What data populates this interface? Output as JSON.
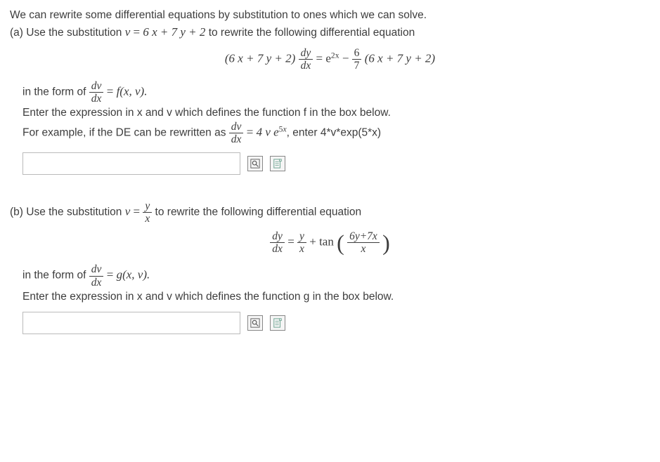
{
  "intro": "We can rewrite some differential equations by substitution to ones which we can solve.",
  "partA": {
    "prefix": "(a) Use the substitution ",
    "sub_lhs": "v",
    "sub_eq": " = ",
    "sub_rhs": "6 x + 7 y + 2",
    "suffix": " to rewrite the following differential equation",
    "eq_lhs_factor": "(6 x + 7 y + 2)",
    "eq_frac_num": "dy",
    "eq_frac_den": "dx",
    "eq_equals": " = ",
    "eq_rhs_e": "e",
    "eq_rhs_exp": "2x",
    "eq_rhs_minus": " − ",
    "eq_rhs_frac_num": "6",
    "eq_rhs_frac_den": "7",
    "eq_rhs_tail": " (6 x + 7 y + 2)",
    "form_prefix": "in the form of ",
    "form_frac_num": "dv",
    "form_frac_den": "dx",
    "form_eq": " = ",
    "form_fn": "f(x, v).",
    "instr": "Enter the expression in x   and v    which defines the function f   in the box below.",
    "example_prefix": "For example, if the DE can be rewritten as ",
    "example_frac_num": "dv",
    "example_frac_den": "dx",
    "example_eq": " = ",
    "example_rhs_a": "4 v e",
    "example_rhs_exp": "5x",
    "example_suffix": ", enter 4*v*exp(5*x)"
  },
  "partB": {
    "prefix": "(b) Use the substitution ",
    "sub_lhs": "v",
    "sub_eq": " = ",
    "sub_frac_num": "y",
    "sub_frac_den": "x",
    "suffix": " to rewrite the following differential equation",
    "eq_lhs_num": "dy",
    "eq_lhs_den": "dx",
    "eq_equals": " = ",
    "eq_rhs_frac1_num": "y",
    "eq_rhs_frac1_den": "x",
    "eq_rhs_plus": " + tan ",
    "eq_rhs_frac2_num": "6y+7x",
    "eq_rhs_frac2_den": "x",
    "form_prefix": "in the form of ",
    "form_frac_num": "dv",
    "form_frac_den": "dx",
    "form_eq": " = ",
    "form_fn": "g(x, v).",
    "instr": "Enter the expression in x   and v  which defines the function g   in the box below."
  }
}
